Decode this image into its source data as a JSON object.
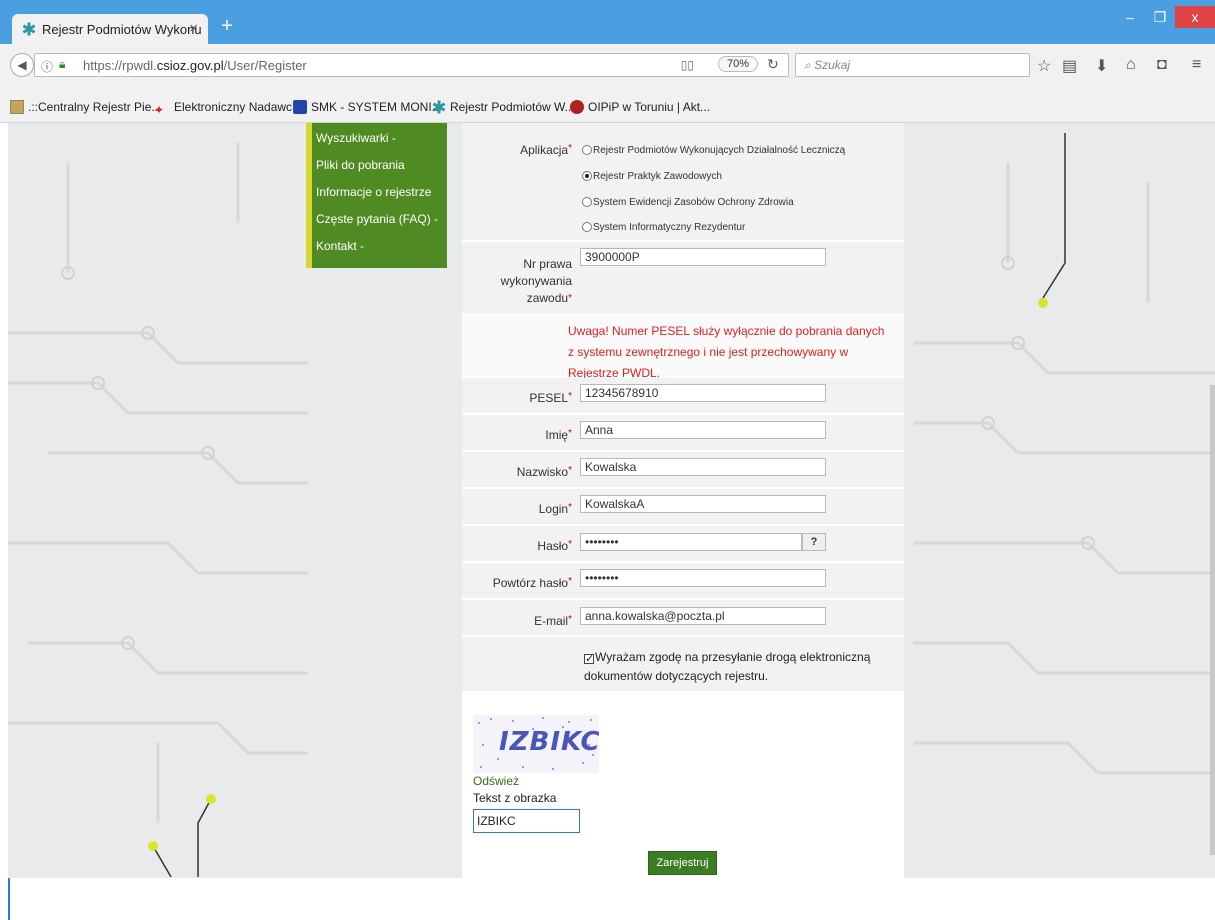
{
  "browser": {
    "tab_title": "Rejestr Podmiotów Wykonu",
    "tab_close": "×",
    "new_tab": "+",
    "url_prefix": "https://rpwdl.",
    "url_domain": "csioz.gov.pl",
    "url_path": "/User/Register",
    "zoom": "70%",
    "search_placeholder": "Szukaj",
    "window_minimize": "–",
    "window_restore": "❐",
    "window_close": "x",
    "bookmarks": [
      ".::Centralny Rejestr Pie...",
      "Elektroniczny Nadawc...",
      "SMK - SYSTEM MONI...",
      "Rejestr Podmiotów W...",
      "OIPiP w Toruniu | Akt..."
    ]
  },
  "menu": {
    "items": [
      "Wyszukiwarki -",
      "Pliki do pobrania",
      "Informacje o rejestrze",
      "Częste pytania (FAQ) -",
      "Kontakt -"
    ]
  },
  "form": {
    "application_label": "Aplikacja",
    "application_options": [
      "Rejestr Podmiotów Wykonujących Działalność Leczniczą",
      "Rejestr Praktyk Zawodowych",
      "System Ewidencji Zasobów Ochrony Zdrowia",
      "System Informatyczny Rezydentur"
    ],
    "application_selected": "Rejestr Praktyk Zawodowych",
    "license_label_1": "Nr prawa",
    "license_label_2": "wykonywania",
    "license_label_3": "zawodu",
    "license_value": "3900000P",
    "warning": "Uwaga! Numer PESEL służy wyłącznie do pobrania danych z systemu zewnętrznego i nie jest przechowywany w Rejestrze PWDL.",
    "pesel_label": "PESEL",
    "pesel_value": "12345678910",
    "first_name_label": "Imię",
    "first_name_value": "Anna",
    "last_name_label": "Nazwisko",
    "last_name_value": "Kowalska",
    "login_label": "Login",
    "login_value": "KowalskaA",
    "password_label": "Hasło",
    "password_value": "••••••••",
    "password_help": "?",
    "password_repeat_label": "Powtórz hasło",
    "password_repeat_value": "••••••••",
    "email_label": "E-mail",
    "email_value": "anna.kowalska@poczta.pl",
    "required_mark": "*",
    "consent_text": "Wyrażam zgodę na przesyłanie drogą elektroniczną dokumentów dotyczących rejestru.",
    "consent_checked": true,
    "captcha_text": "IZBIKC",
    "refresh_label": "Odśwież",
    "captcha_label": "Tekst z obrazka",
    "captcha_value": "IZBIKC",
    "submit_label": "Zarejestruj się"
  },
  "colors": {
    "titlebar": "#4a9fe0",
    "menu_bg": "#4f8a23",
    "menu_accent": "#d8d630",
    "warning": "#e02020",
    "submit_bg": "#3b7d22"
  }
}
